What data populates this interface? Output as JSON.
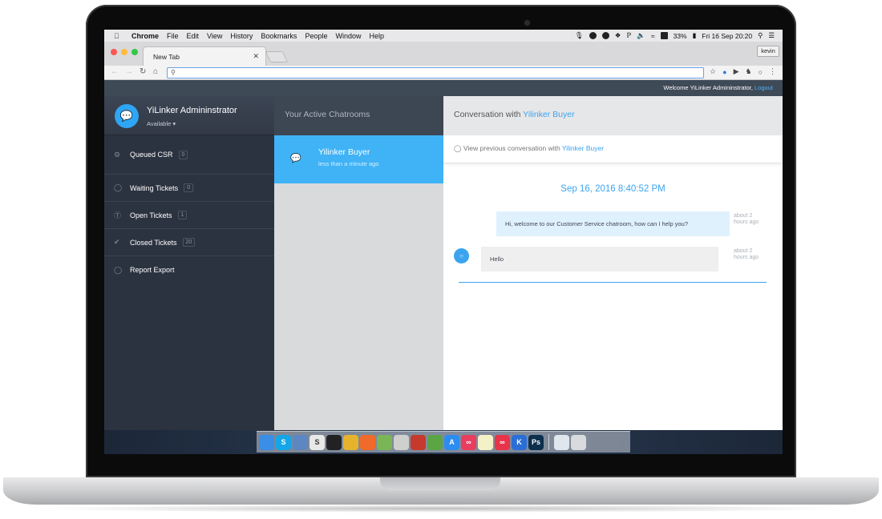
{
  "menubar": {
    "items": [
      "Chrome",
      "File",
      "Edit",
      "View",
      "History",
      "Bookmarks",
      "People",
      "Window",
      "Help"
    ],
    "battery": "33%",
    "clock": "Fri 16 Sep  20:20"
  },
  "browser": {
    "tab_title": "New Tab",
    "profile": "kevin",
    "omnibox_value": ""
  },
  "app": {
    "welcome_text": "Welcome YiLinker Admininstrator,",
    "logout_label": "Logout",
    "profile": {
      "name": "YiLinker Admininstrator",
      "status": "Available"
    },
    "sidebar": [
      {
        "label": "Queued CSR",
        "count": "0",
        "icon": "gear-icon"
      },
      {
        "label": "Waiting Tickets",
        "count": "0",
        "icon": "chat-icon"
      },
      {
        "label": "Open Tickets",
        "count": "1",
        "icon": "headset-icon"
      },
      {
        "label": "Closed Tickets",
        "count": "20",
        "icon": "check-icon"
      },
      {
        "label": "Report Export",
        "count": "",
        "icon": "chat-icon"
      }
    ],
    "chatrooms": {
      "title": "Your Active Chatrooms",
      "items": [
        {
          "name": "Yilinker Buyer",
          "time": "less than a minute ago"
        }
      ]
    },
    "conversation": {
      "prefix": "Conversation with",
      "name": "Yilinker Buyer",
      "prev_prefix": "View previous conversation with",
      "prev_name": "Yilinker Buyer",
      "date": "Sep 16, 2016 8:40:52 PM",
      "messages": [
        {
          "direction": "out",
          "text": "Hi, welcome to our Customer Service chatroom, how can I help you?",
          "time1": "about 2",
          "time2": "hours ago"
        },
        {
          "direction": "in",
          "text": "Hello",
          "time1": "about 2",
          "time2": "hours ago"
        }
      ]
    }
  },
  "dock": {
    "apps": [
      {
        "icon": "finder-icon",
        "color": "#3a8ee6",
        "glyph": ""
      },
      {
        "icon": "skype-icon",
        "color": "#14a6e8",
        "glyph": "S"
      },
      {
        "icon": "preview-icon",
        "color": "#5d87c2",
        "glyph": ""
      },
      {
        "icon": "sublime-icon",
        "color": "#e8e8e8",
        "glyph": "S"
      },
      {
        "icon": "terminal-icon",
        "color": "#222222",
        "glyph": ""
      },
      {
        "icon": "chrome-icon",
        "color": "#e5b32c",
        "glyph": ""
      },
      {
        "icon": "postman-icon",
        "color": "#f06a2a",
        "glyph": ""
      },
      {
        "icon": "android-icon",
        "color": "#7ab656",
        "glyph": ""
      },
      {
        "icon": "sequel-icon",
        "color": "#cfcfcf",
        "glyph": ""
      },
      {
        "icon": "redis-icon",
        "color": "#c63a2d",
        "glyph": ""
      },
      {
        "icon": "rocket-icon",
        "color": "#5ba545",
        "glyph": ""
      },
      {
        "icon": "appstore-icon",
        "color": "#2d8cf0",
        "glyph": "A"
      },
      {
        "icon": "flickr-icon",
        "color": "#e93d5f",
        "glyph": "∞"
      },
      {
        "icon": "notes-icon",
        "color": "#f4f1c9",
        "glyph": ""
      },
      {
        "icon": "ooo-icon",
        "color": "#e8344a",
        "glyph": "∞"
      },
      {
        "icon": "ki-icon",
        "color": "#2b6fd6",
        "glyph": "K"
      },
      {
        "icon": "photoshop-icon",
        "color": "#0b2f4d",
        "glyph": "Ps"
      }
    ],
    "extras": [
      {
        "icon": "folder-icon",
        "color": "#dfe6ee",
        "glyph": ""
      },
      {
        "icon": "trash-icon",
        "color": "#d8dadd",
        "glyph": ""
      }
    ]
  }
}
